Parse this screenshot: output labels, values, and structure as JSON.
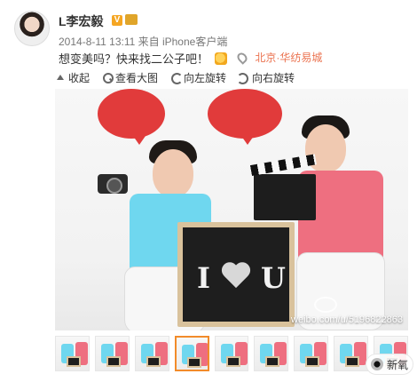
{
  "user": {
    "name": "L李宏毅",
    "verified": "V"
  },
  "post": {
    "meta": "2014-8-11 13:11 来自 iPhone客户端",
    "text": "想变美吗？快来找二公子吧！",
    "location": "北京·华纺易城"
  },
  "toolbar": {
    "items": [
      {
        "label": "收起",
        "icon": "collapse-up-icon"
      },
      {
        "label": "查看大图",
        "icon": "search-icon"
      },
      {
        "label": "向左旋转",
        "icon": "rotate-left-icon"
      },
      {
        "label": "向右旋转",
        "icon": "rotate-right-icon"
      }
    ]
  },
  "photo": {
    "bubble_left": "",
    "bubble_right": "",
    "clapper_text": "",
    "board_left": "I",
    "board_right": "U",
    "watermark": "weibo.com/u/5196822863"
  },
  "thumbs": {
    "count": 9,
    "active_index": 3
  },
  "badge": {
    "label": "新氧"
  }
}
